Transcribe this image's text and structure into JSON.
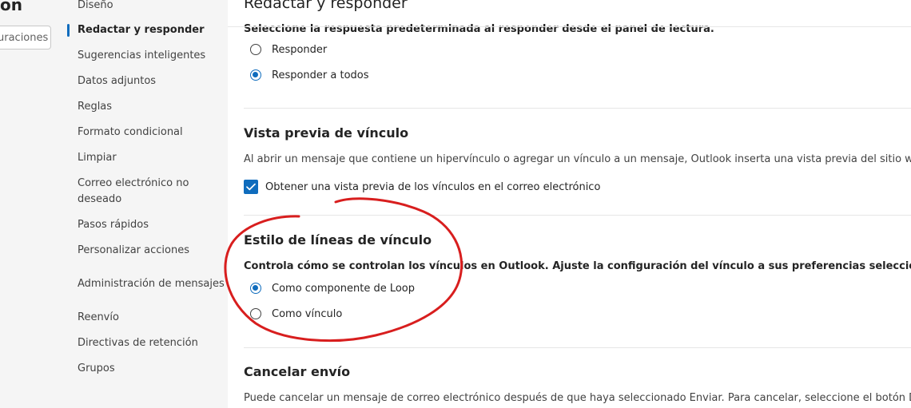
{
  "left_panel": {
    "title_fragment": "on",
    "search_value": "uraciones"
  },
  "nav": {
    "items": [
      {
        "label": "Diseño",
        "active": false
      },
      {
        "label": "Redactar y responder",
        "active": true
      },
      {
        "label": "Sugerencias inteligentes",
        "active": false
      },
      {
        "label": "Datos adjuntos",
        "active": false
      },
      {
        "label": "Reglas",
        "active": false
      },
      {
        "label": "Formato condicional",
        "active": false
      },
      {
        "label": "Limpiar",
        "active": false
      },
      {
        "label": "Correo electrónico no deseado",
        "active": false
      },
      {
        "label": "Pasos rápidos",
        "active": false
      },
      {
        "label": "Personalizar acciones",
        "active": false
      },
      {
        "label": "Administración de mensajes",
        "active": false
      },
      {
        "label": "Reenvío",
        "active": false
      },
      {
        "label": "Directivas de retención",
        "active": false
      },
      {
        "label": "Grupos",
        "active": false
      }
    ]
  },
  "content": {
    "page_title": "Redactar y responder",
    "reply_section": {
      "description": "Seleccione la respuesta predeterminada al responder desde el panel de lectura.",
      "options": [
        {
          "label": "Responder",
          "selected": false
        },
        {
          "label": "Responder a todos",
          "selected": true
        }
      ]
    },
    "link_preview": {
      "title": "Vista previa de vínculo",
      "description": "Al abrir un mensaje que contiene un hipervínculo o agregar un vínculo a un mensaje, Outlook inserta una vista previa del sitio web. Si no",
      "checkbox_label": "Obtener una vista previa de los vínculos en el correo electrónico",
      "checked": true
    },
    "link_style": {
      "title": "Estilo de líneas de vínculo",
      "description": "Controla cómo se controlan los vínculos en Outlook. Ajuste la configuración del vínculo a sus preferencias seleccionando si desea ve",
      "options": [
        {
          "label": "Como componente de Loop",
          "selected": true
        },
        {
          "label": "Como vínculo",
          "selected": false
        }
      ]
    },
    "undo_send": {
      "title": "Cancelar envío",
      "description": "Puede cancelar un mensaje de correo electrónico después de que haya seleccionado Enviar. Para cancelar, seleccione el botón Deshacer"
    }
  },
  "colors": {
    "accent": "#0f6cbd",
    "annotation": "#d81e1e",
    "nav_bg": "#f5f5f5"
  }
}
